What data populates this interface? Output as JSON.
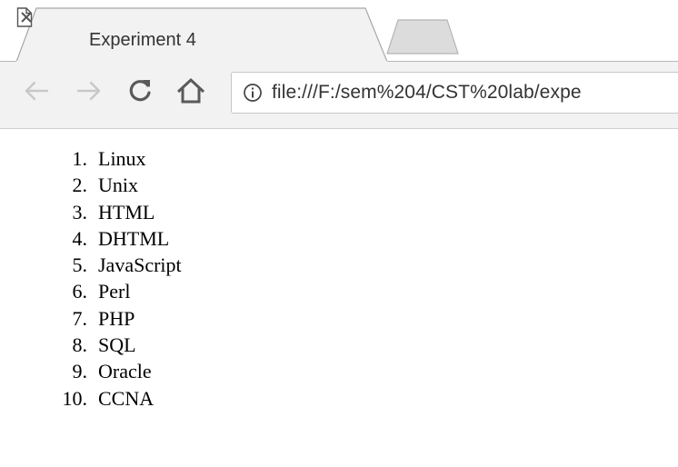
{
  "browser": {
    "tab": {
      "title": "Experiment 4",
      "icon": "document-icon",
      "close_icon": "close-icon"
    },
    "new_tab_icon": "new-tab-icon",
    "toolbar": {
      "back_icon": "back-arrow-icon",
      "forward_icon": "forward-arrow-icon",
      "reload_icon": "reload-icon",
      "home_icon": "home-icon",
      "info_icon": "info-icon",
      "url": "file:///F:/sem%204/CST%20lab/expe"
    },
    "colors": {
      "chrome_bg": "#f2f2f2",
      "tab_bg": "#ffffff",
      "disabled_icon": "#c8c8c8",
      "enabled_icon": "#5a5a5a"
    }
  },
  "page": {
    "list": [
      {
        "number": "1.",
        "text": "Linux"
      },
      {
        "number": "2.",
        "text": "Unix"
      },
      {
        "number": "3.",
        "text": "HTML"
      },
      {
        "number": "4.",
        "text": "DHTML"
      },
      {
        "number": "5.",
        "text": "JavaScript"
      },
      {
        "number": "6.",
        "text": "Perl"
      },
      {
        "number": "7.",
        "text": "PHP"
      },
      {
        "number": "8.",
        "text": "SQL"
      },
      {
        "number": "9.",
        "text": "Oracle"
      },
      {
        "number": "10.",
        "text": "CCNA"
      }
    ]
  }
}
